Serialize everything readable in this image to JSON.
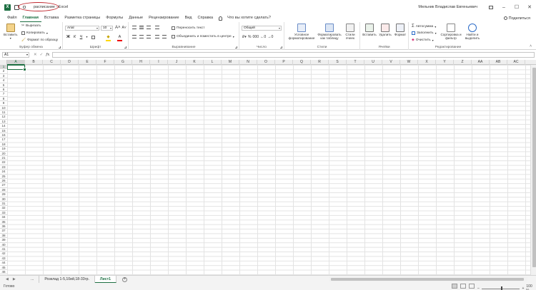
{
  "app": {
    "doc_title": "расписание - Excel",
    "user_name": "Мельник Владислав Евгеньевич",
    "share_label": "Поделиться"
  },
  "tabs": [
    "Файл",
    "Главная",
    "Вставка",
    "Разметка страницы",
    "Формулы",
    "Данные",
    "Рецензирование",
    "Вид",
    "Справка"
  ],
  "tell_me": "Что вы хотите сделать?",
  "ribbon": {
    "clipboard": {
      "paste": "Вставить",
      "cut": "Вырезать",
      "copy": "Копировать",
      "format_painter": "Формат по образцу",
      "label": "Буфер обмена"
    },
    "font": {
      "name": "Arial",
      "size": "10",
      "bold": "Ж",
      "italic": "К",
      "underline": "Ч",
      "label": "Шрифт"
    },
    "alignment": {
      "wrap": "Переносить текст",
      "merge": "Объединить и поместить в центре",
      "label": "Выравнивание"
    },
    "number": {
      "format": "Общий",
      "label": "Число"
    },
    "styles": {
      "conditional": "Условное форматирование",
      "as_table": "Форматировать как таблицу",
      "cell_styles": "Стили ячеек",
      "label": "Стили"
    },
    "cells": {
      "insert": "Вставить",
      "delete": "Удалить",
      "format": "Формат",
      "label": "Ячейки"
    },
    "editing": {
      "autosum": "Автосумма",
      "fill": "Заполнить",
      "clear": "Очистить",
      "sort": "Сортировка и фильтр",
      "find": "Найти и выделить",
      "label": "Редактирование"
    }
  },
  "formula_bar": {
    "name_box": "A1",
    "fx": "fx"
  },
  "columns": [
    "A",
    "B",
    "C",
    "D",
    "E",
    "F",
    "G",
    "H",
    "I",
    "J",
    "K",
    "L",
    "M",
    "N",
    "O",
    "P",
    "Q",
    "R",
    "S",
    "T",
    "U",
    "V",
    "W",
    "X",
    "Y",
    "Z",
    "AA",
    "AB",
    "AC"
  ],
  "rows": [
    "1",
    "2",
    "3",
    "4",
    "5",
    "6",
    "7",
    "8",
    "9",
    "10",
    "11",
    "12",
    "13",
    "14",
    "15",
    "16",
    "17",
    "18",
    "19",
    "20",
    "21",
    "22",
    "23",
    "24",
    "25",
    "26",
    "27",
    "28",
    "29",
    "30",
    "31",
    "32",
    "33",
    "34",
    "35",
    "36",
    "37",
    "38",
    "39",
    "40",
    "41",
    "42",
    "43",
    "44",
    "45",
    "46"
  ],
  "sheets": {
    "nav_prev": "◀",
    "nav_next": "▶",
    "dots": "...",
    "tab1": "Розклад 1-5,10ий,18-33гр.",
    "tab2": "Лист1"
  },
  "status": {
    "ready": "Готово",
    "zoom": "100 %"
  }
}
